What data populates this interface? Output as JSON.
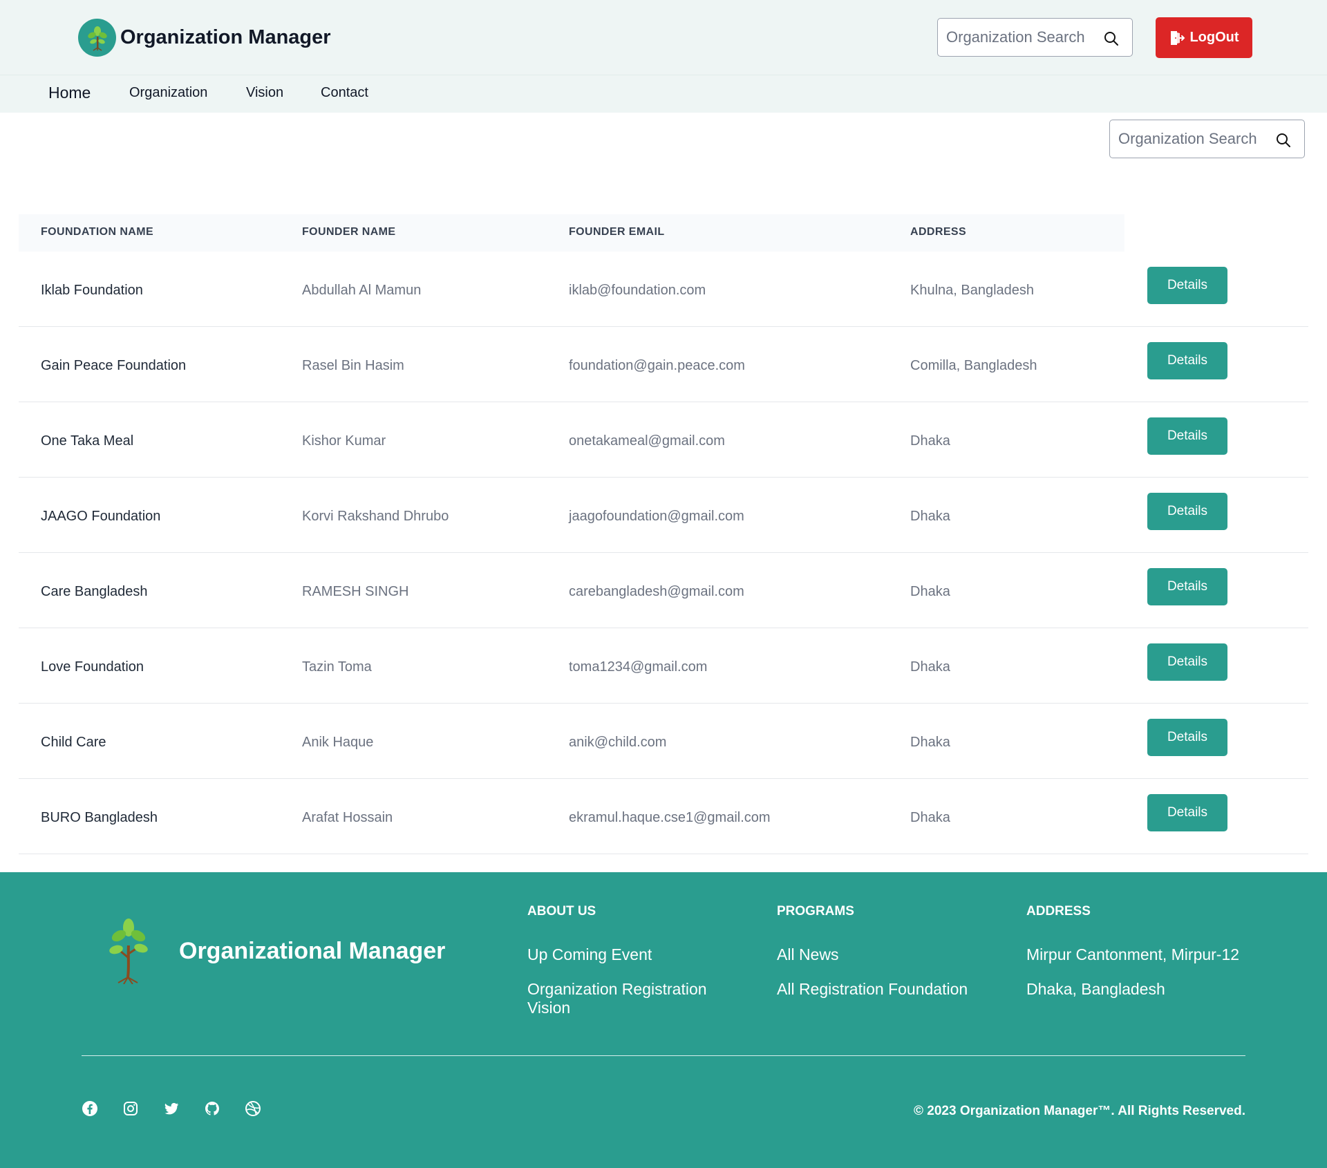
{
  "header": {
    "title": "Organization Manager",
    "search_placeholder": "Organization Search",
    "logout_label": "LogOut"
  },
  "nav": {
    "items": [
      {
        "label": "Home"
      },
      {
        "label": "Organization"
      },
      {
        "label": "Vision"
      },
      {
        "label": "Contact"
      }
    ]
  },
  "main": {
    "search_placeholder": "Organization Search"
  },
  "table": {
    "columns": [
      "FOUNDATION NAME",
      "FOUNDER NAME",
      "FOUNDER EMAIL",
      "ADDRESS"
    ],
    "details_label": "Details",
    "rows": [
      {
        "name": "Iklab Foundation",
        "founder": "Abdullah Al Mamun",
        "email": "iklab@foundation.com",
        "address": "Khulna, Bangladesh"
      },
      {
        "name": "Gain Peace Foundation",
        "founder": "Rasel Bin Hasim",
        "email": "foundation@gain.peace.com",
        "address": "Comilla, Bangladesh"
      },
      {
        "name": "One Taka Meal",
        "founder": "Kishor Kumar",
        "email": "onetakameal@gmail.com",
        "address": "Dhaka"
      },
      {
        "name": "JAAGO Foundation",
        "founder": "Korvi Rakshand Dhrubo",
        "email": "jaagofoundation@gmail.com",
        "address": "Dhaka"
      },
      {
        "name": "Care Bangladesh",
        "founder": "RAMESH SINGH",
        "email": "carebangladesh@gmail.com",
        "address": "Dhaka"
      },
      {
        "name": "Love Foundation",
        "founder": "Tazin Toma",
        "email": "toma1234@gmail.com",
        "address": "Dhaka"
      },
      {
        "name": "Child Care",
        "founder": "Anik Haque",
        "email": "anik@child.com",
        "address": "Dhaka"
      },
      {
        "name": "BURO Bangladesh",
        "founder": "Arafat Hossain",
        "email": "ekramul.haque.cse1@gmail.com",
        "address": "Dhaka"
      }
    ]
  },
  "footer": {
    "brand": "Organizational Manager",
    "about": {
      "heading": "ABOUT US",
      "links": [
        "Up Coming Event",
        "Organization Registration Vision"
      ]
    },
    "programs": {
      "heading": "PROGRAMS",
      "links": [
        "All News",
        "All Registration Foundation"
      ]
    },
    "address": {
      "heading": "ADDRESS",
      "lines": [
        "Mirpur Cantonment, Mirpur-12",
        "Dhaka, Bangladesh"
      ]
    },
    "socials": [
      "facebook-icon",
      "instagram-icon",
      "twitter-icon",
      "github-icon",
      "dribbble-icon"
    ],
    "copyright": "© 2023 Organization Manager™. All Rights Reserved."
  },
  "colors": {
    "accent": "#2a9d8f",
    "logout": "#dc2626",
    "header_bg": "#eef5f4"
  }
}
